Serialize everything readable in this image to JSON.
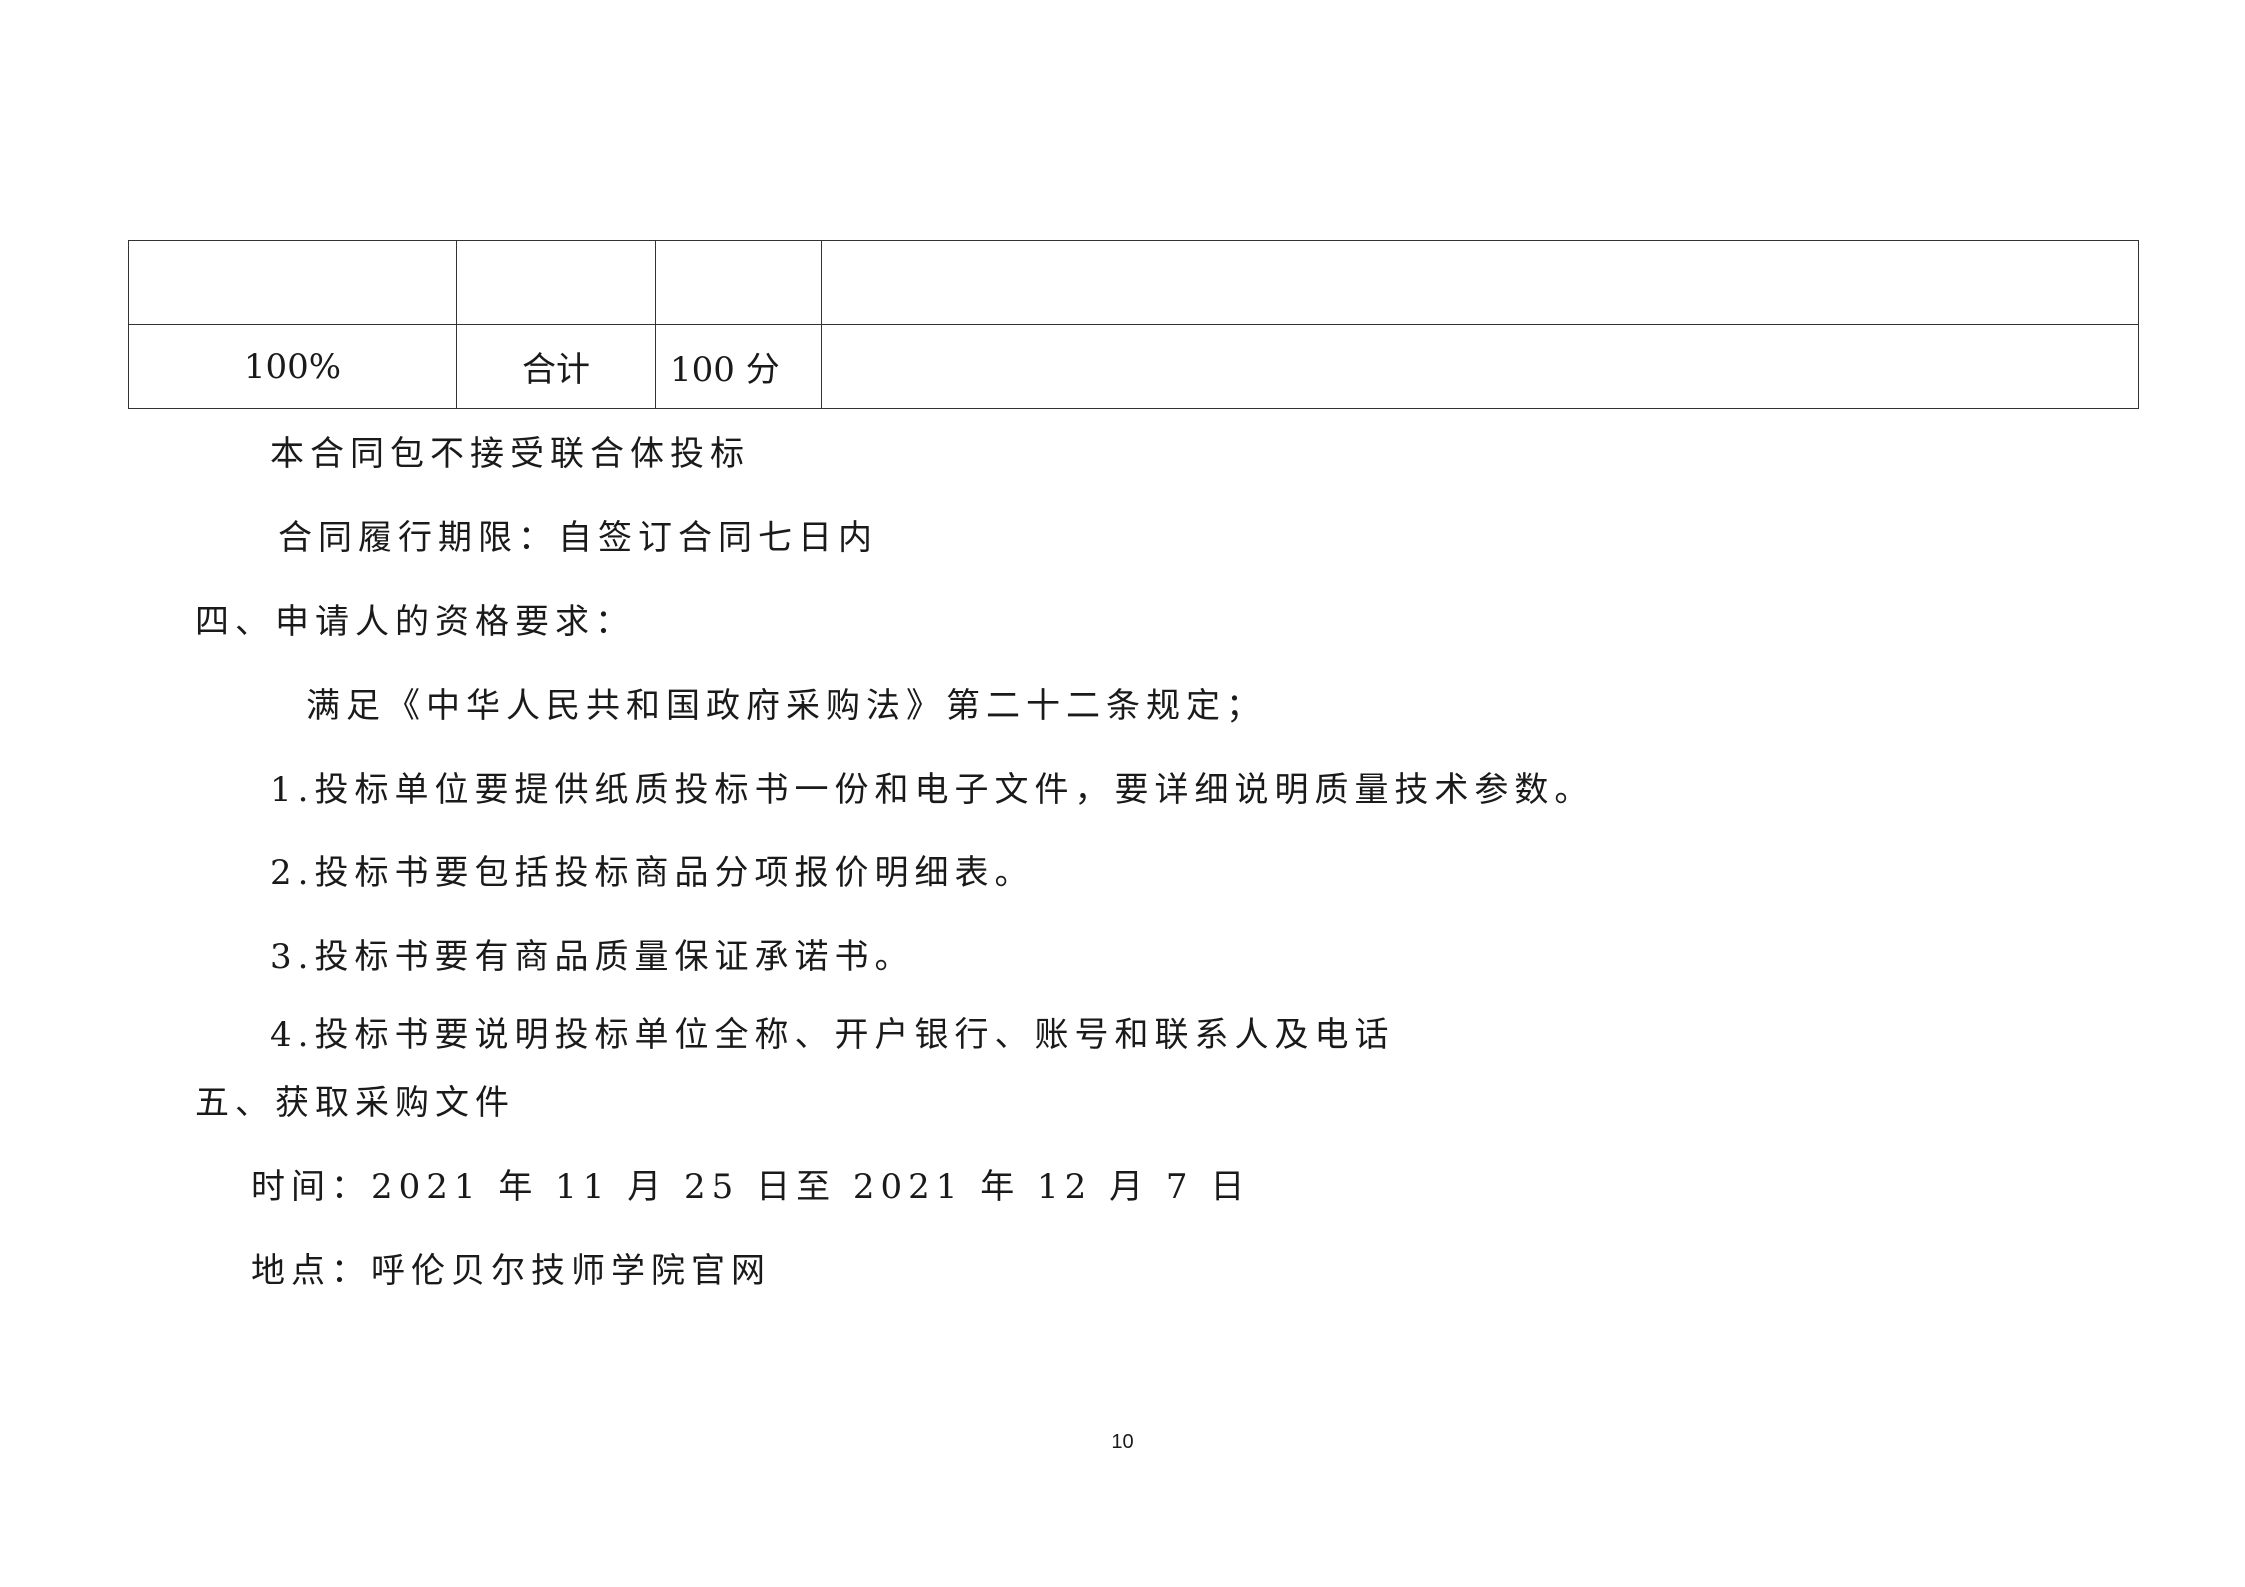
{
  "table": {
    "rows": [
      [
        "",
        "",
        "",
        ""
      ],
      [
        "100%",
        "合计",
        "100 分",
        ""
      ]
    ]
  },
  "paragraphs": {
    "no_consortium": "本合同包不接受联合体投标",
    "performance_period": "合同履行期限：自签订合同七日内",
    "section4_heading": "四、申请人的资格要求：",
    "law_requirement": "满足《中华人民共和国政府采购法》第二十二条规定；",
    "item1": "1.投标单位要提供纸质投标书一份和电子文件，要详细说明质量技术参数。",
    "item2": "2.投标书要包括投标商品分项报价明细表。",
    "item3": "3.投标书要有商品质量保证承诺书。",
    "item4": "4.投标书要说明投标单位全称、开户银行、账号和联系人及电话",
    "section5_heading": "五、获取采购文件",
    "time": "时间：2021 年 11 月 25 日至 2021 年 12 月 7 日",
    "location": "地点：呼伦贝尔技师学院官网"
  },
  "footer": {
    "page_number": "10"
  }
}
